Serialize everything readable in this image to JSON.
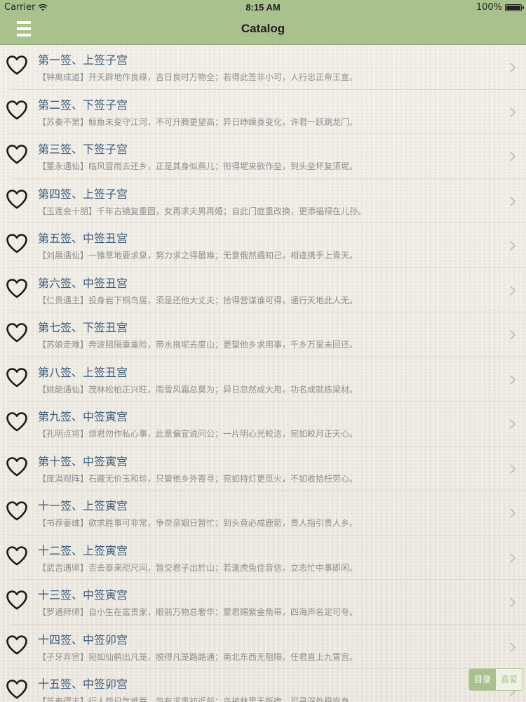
{
  "status_bar": {
    "carrier": "Carrier",
    "time": "8:15 AM",
    "battery": "100%"
  },
  "nav": {
    "title": "Catalog"
  },
  "colors": {
    "accent": "#a9c28d",
    "title_text": "#3a5a7a",
    "subtitle_text": "#8f8f8f"
  },
  "items": [
    {
      "title": "第一签、上签子宫",
      "tag": "【钟离成道】",
      "text": "开天辟地作良缘，吉日良时万物全；若得此签非小可，人行忠正帝王宣。"
    },
    {
      "title": "第二签、下签子宫",
      "tag": "【苏秦不第】",
      "text": "鲸鱼未变守江河，不可升腾更望高；异日峥嵘身变化，许君一跃跳龙门。"
    },
    {
      "title": "第三签、下签子宫",
      "tag": "【董永遇仙】",
      "text": "临风冒雨去还乡，正是其身似燕儿；衔得坭来欲作垒，到头垒坏复须坭。"
    },
    {
      "title": "第四签、上签子宫",
      "tag": "【玉莲会十朋】",
      "text": "千年古镜复重圆，女再求夫男再婚；自此门庭重改换，更添福禄在儿孙。"
    },
    {
      "title": "第五签、中签丑宫",
      "tag": "【刘晨遇仙】",
      "text": "一锥草地要求泉，努力求之得最难；无意俄然遇知己，相逢携手上青天。"
    },
    {
      "title": "第六签、中签丑宫",
      "tag": "【仁贵遇主】",
      "text": "投身岩下铜鸟居，须是还他大丈夫；拾得营谋谁可得，通行天地此人无。"
    },
    {
      "title": "第七签、下签丑宫",
      "tag": "【苏娘走难】",
      "text": "奔波阻隔重重险，带水拖坭去度山；更望他乡求用事，千乡万里未回还。"
    },
    {
      "title": "第八签、上签丑宫",
      "tag": "【姚能遇仙】",
      "text": "茂林松柏正兴旺，雨雪风霜总莫为；异日忽然成大用，功名成就栋梁材。"
    },
    {
      "title": "第九签、中签寅宫",
      "tag": "【孔明点将】",
      "text": "烦君勿作私心事，此意偏宜说问公；一片明心光皎洁，宛如皎月正天心。"
    },
    {
      "title": "第十签、中签寅宫",
      "tag": "【庞涓观阵】",
      "text": "石藏无价玉和珍，只管他乡外寄寻；宛如持灯更觅火，不如收拾枉劳心。"
    },
    {
      "title": "十一签、上签寅宫",
      "tag": "【书荐姜维】",
      "text": "欲求胜事可非常，争奈亲姻日暂忙；到头竟必成鹿箭，贵人指引贵人乡。"
    },
    {
      "title": "十二签、上签寅宫",
      "tag": "【武吉遇师】",
      "text": "否去泰来咫尺间，暂交君子出於山；若逢虎兔佳音信，立志忙中事即闲。"
    },
    {
      "title": "十三签、中签寅宫",
      "tag": "【罗通拜师】",
      "text": "自小生在富贵家，眼前万物总奢华；蒙君赐紫金角带，四海声名定可夸。"
    },
    {
      "title": "十四签、中签卯宫",
      "tag": "【子牙弃官】",
      "text": "宛如仙鹤出凡笼，脱得凡笼路路通；南北东西无阻隔，任君直上九霄宫。"
    },
    {
      "title": "十五签、中签卯宫",
      "tag": "【苏秦得志】",
      "text": "行人怨日气难吞，忽有求事初近前；鸟被林里无所宿，可寻深处稳安身。"
    }
  ],
  "tabs": {
    "catalog_label": "目录",
    "favorites_label": "喜爱"
  }
}
